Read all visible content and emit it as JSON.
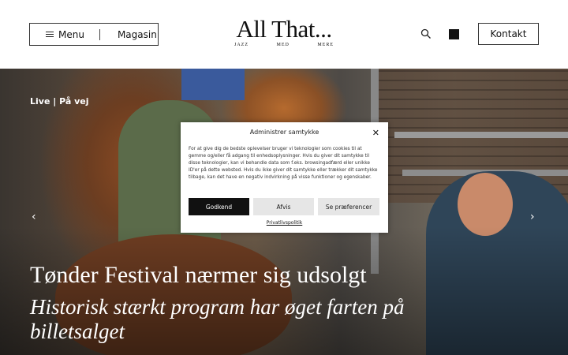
{
  "header": {
    "menu_label": "Menu",
    "magasin_label": "Magasin",
    "logo_title": "All That...",
    "logo_sub": [
      "JAZZ",
      "MED",
      "MERE"
    ],
    "contact_label": "Kontakt",
    "search_icon": "search-icon",
    "cart_icon": "cart-icon"
  },
  "hero": {
    "breadcrumb": "Live | På vej",
    "headline": "Tønder Festival nærmer sig udsolgt",
    "subline": "Historisk stærkt program har øget farten på billetsalget",
    "prev_arrow": "‹",
    "next_arrow": "›"
  },
  "consent": {
    "title": "Administrer samtykke",
    "close": "✕",
    "text": "For at give dig de bedste oplevelser bruger vi teknologier som cookies til at gemme og/eller få adgang til enhedsoplysninger. Hvis du giver dit samtykke til disse teknologier, kan vi behandle data som f.eks. browsingadfærd eller unikke ID'er på dette websted. Hvis du ikke giver dit samtykke eller trækker dit samtykke tilbage, kan det have en negativ indvirkning på visse funktioner og egenskaber.",
    "accept": "Godkend",
    "deny": "Afvis",
    "preferences": "Se præferencer",
    "policy_link": "Privatlivspolitik"
  }
}
